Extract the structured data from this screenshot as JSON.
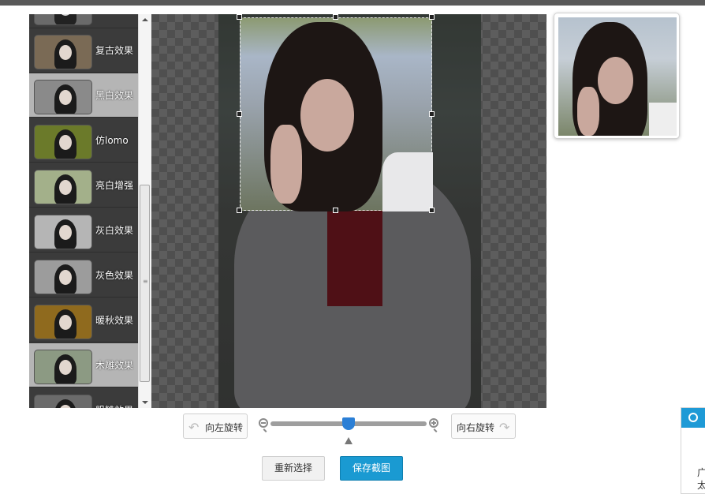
{
  "effects": [
    {
      "label": "复古效果",
      "tone": "#7a6a55",
      "selected": false
    },
    {
      "label": "黑白效果",
      "tone": "#8a8a8a",
      "selected": true
    },
    {
      "label": "仿lomo",
      "tone": "#6b7a2a",
      "selected": false
    },
    {
      "label": "亮白增强",
      "tone": "#a3b08a",
      "selected": false
    },
    {
      "label": "灰白效果",
      "tone": "#b5b5b5",
      "selected": false
    },
    {
      "label": "灰色效果",
      "tone": "#9c9c9c",
      "selected": false
    },
    {
      "label": "暖秋效果",
      "tone": "#8f6a1e",
      "selected": false
    },
    {
      "label": "木雕效果",
      "tone": "#8c9a83",
      "selected": true
    },
    {
      "label": "粗糙效果",
      "tone": "#6b6b6b",
      "selected": false
    }
  ],
  "controls": {
    "rotate_left": "向左旋转",
    "rotate_right": "向右旋转",
    "zoom_level": 0.5
  },
  "actions": {
    "reselect": "重新选择",
    "save": "保存截图"
  },
  "side_widget": {
    "text": "广\n太"
  },
  "colors": {
    "accent": "#1a9ad2",
    "slider_knob": "#2b7fd6"
  }
}
